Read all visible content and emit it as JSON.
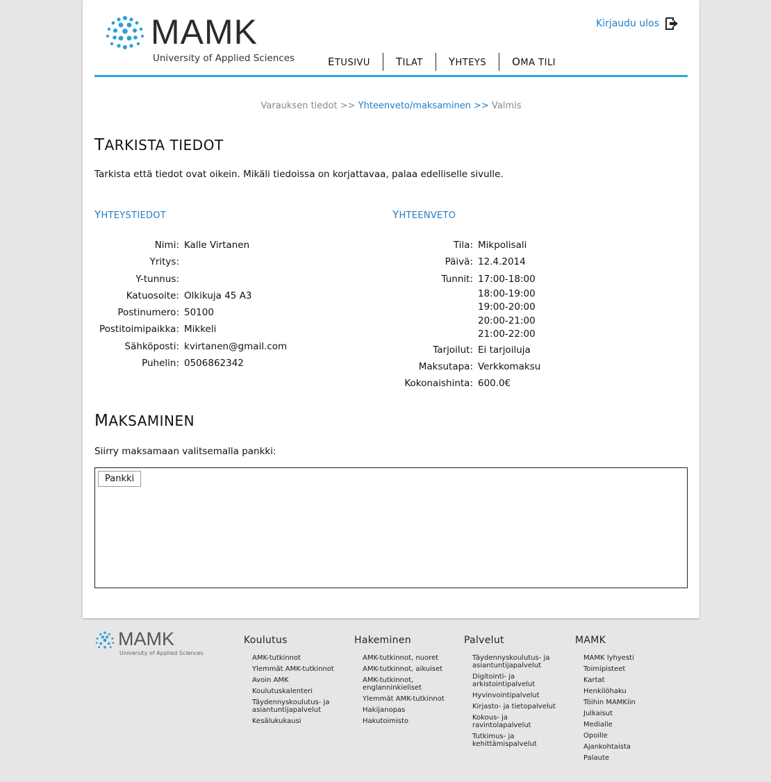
{
  "header": {
    "logo_word": "MAMK",
    "logo_sub": "University of Applied Sciences",
    "logout_label": "Kirjaudu ulos",
    "nav": [
      {
        "first": "E",
        "rest": "TUSIVU"
      },
      {
        "first": "T",
        "rest": "ILAT"
      },
      {
        "first": "Y",
        "rest": "HTEYS"
      },
      {
        "first": "O",
        "rest": "MA TILI"
      }
    ]
  },
  "breadcrumb": {
    "step1": "Varauksen tiedot >> ",
    "step2": "Yhteenveto/maksaminen >> ",
    "step3": "Valmis"
  },
  "check": {
    "title_first": "T",
    "title_rest": "ARKISTA TIEDOT",
    "intro": "Tarkista että tiedot ovat oikein. Mikäli tiedoissa on korjattavaa, palaa edelliselle sivulle."
  },
  "contact": {
    "title_first": "Y",
    "title_rest": "HTEYSTIEDOT",
    "rows": [
      {
        "label": "Nimi:",
        "value": "Kalle Virtanen"
      },
      {
        "label": "Yritys:",
        "value": ""
      },
      {
        "label": "Y-tunnus:",
        "value": ""
      },
      {
        "label": "Katuosoite:",
        "value": "Olkikuja 45 A3"
      },
      {
        "label": "Postinumero:",
        "value": "50100"
      },
      {
        "label": "Postitoimipaikka:",
        "value": "Mikkeli"
      },
      {
        "label": "Sähköposti:",
        "value": "kvirtanen@gmail.com"
      },
      {
        "label": "Puhelin:",
        "value": "0506862342"
      }
    ]
  },
  "summary": {
    "title_first": "Y",
    "title_rest": "HTEENVETO",
    "tila_label": "Tila:",
    "tila": "Mikpolisali",
    "paiva_label": "Päivä:",
    "paiva": "12.4.2014",
    "tunnit_label": "Tunnit:",
    "tunnit": [
      "17:00-18:00",
      "18:00-19:00",
      "19:00-20:00",
      "20:00-21:00",
      "21:00-22:00"
    ],
    "tarjoilut_label": "Tarjoilut:",
    "tarjoilut": "Ei tarjoiluja",
    "maksutapa_label": "Maksutapa:",
    "maksutapa": "Verkkomaksu",
    "hinta_label": "Kokonaishinta:",
    "hinta": "600.0€"
  },
  "payment": {
    "title_first": "M",
    "title_rest": "AKSAMINEN",
    "note": "Siirry maksamaan valitsemalla pankki:",
    "bank_button": "Pankki"
  },
  "footer": {
    "logo_word": "MAMK",
    "logo_sub": "University of Applied Sciences",
    "columns": [
      {
        "title": "Koulutus",
        "items": [
          "AMK-tutkinnot",
          "Ylemmät AMK-tutkinnot",
          "Avoin AMK",
          "Koulutuskalenteri",
          "Täydennyskoulutus- ja asiantuntijapalvelut",
          "Kesälukukausi"
        ]
      },
      {
        "title": "Hakeminen",
        "items": [
          "AMK-tutkinnot, nuoret",
          "AMK-tutkinnot, aikuiset",
          "AMK-tutkinnot, englanninkieliset",
          "Ylemmät AMK-tutkinnot",
          "Hakijanopas",
          "Hakutoimisto"
        ]
      },
      {
        "title": "Palvelut",
        "items": [
          "Täydennyskoulutus- ja asiantuntijapalvelut",
          "Digitointi- ja arkistointipalvelut",
          "Hyvinvointipalvelut",
          "Kirjasto- ja tietopalvelut",
          "Kokous- ja ravintolapalvelut",
          "Tutkimus- ja kehittämispalvelut"
        ]
      },
      {
        "title": "MAMK",
        "items": [
          "MAMK lyhyesti",
          "Toimipisteet",
          "Kartat",
          "Henkilöhaku",
          "Töihin MAMKiin",
          "Julkaisut",
          "Medialle",
          "Opoille",
          "Ajankohtaista",
          "Palaute"
        ]
      }
    ]
  },
  "colors": {
    "accent": "#1f7fc7",
    "rule": "#22a8e0",
    "logo_dots": "#2a9fd6"
  },
  "icons": {
    "logout": "logout-arrow-icon",
    "logo": "mamk-dots-logo"
  }
}
